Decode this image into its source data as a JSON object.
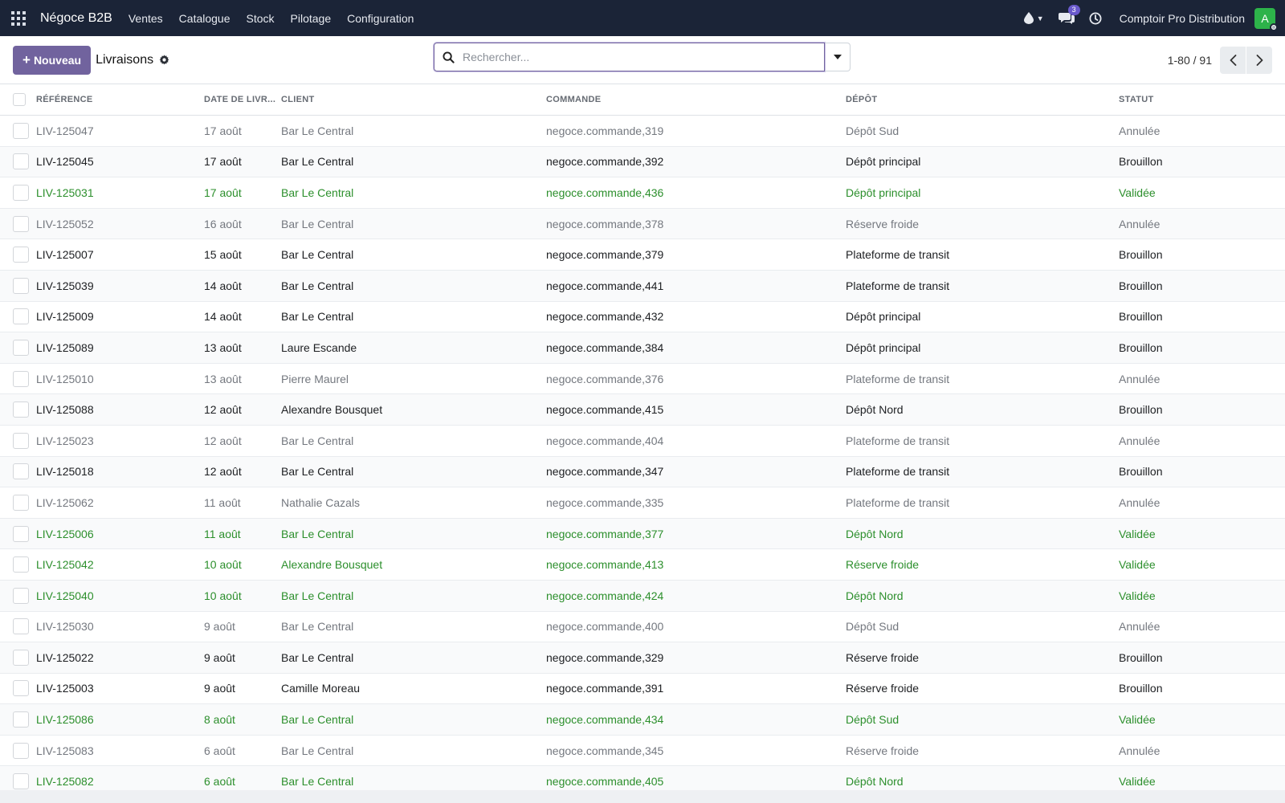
{
  "navbar": {
    "app_name": "Négoce B2B",
    "menu": [
      "Ventes",
      "Catalogue",
      "Stock",
      "Pilotage",
      "Configuration"
    ],
    "messages_count": "3",
    "company": "Comptoir Pro Distribution",
    "avatar_letter": "A"
  },
  "control_panel": {
    "new_button": "Nouveau",
    "title": "Livraisons",
    "search_placeholder": "Rechercher...",
    "pager": "1-80 / 91"
  },
  "table": {
    "headers": [
      "RÉFÉRENCE",
      "DATE DE LIVR...",
      "CLIENT",
      "COMMANDE",
      "DÉPÔT",
      "STATUT"
    ],
    "rows": [
      {
        "ref": "LIV-125047",
        "date": "17 août",
        "client": "Bar Le Central",
        "order": "negoce.commande,319",
        "depot": "Dépôt Sud",
        "status": "Annulée",
        "state": "cancel"
      },
      {
        "ref": "LIV-125045",
        "date": "17 août",
        "client": "Bar Le Central",
        "order": "negoce.commande,392",
        "depot": "Dépôt principal",
        "status": "Brouillon",
        "state": "draft"
      },
      {
        "ref": "LIV-125031",
        "date": "17 août",
        "client": "Bar Le Central",
        "order": "negoce.commande,436",
        "depot": "Dépôt principal",
        "status": "Validée",
        "state": "done"
      },
      {
        "ref": "LIV-125052",
        "date": "16 août",
        "client": "Bar Le Central",
        "order": "negoce.commande,378",
        "depot": "Réserve froide",
        "status": "Annulée",
        "state": "cancel"
      },
      {
        "ref": "LIV-125007",
        "date": "15 août",
        "client": "Bar Le Central",
        "order": "negoce.commande,379",
        "depot": "Plateforme de transit",
        "status": "Brouillon",
        "state": "draft"
      },
      {
        "ref": "LIV-125039",
        "date": "14 août",
        "client": "Bar Le Central",
        "order": "negoce.commande,441",
        "depot": "Plateforme de transit",
        "status": "Brouillon",
        "state": "draft"
      },
      {
        "ref": "LIV-125009",
        "date": "14 août",
        "client": "Bar Le Central",
        "order": "negoce.commande,432",
        "depot": "Dépôt principal",
        "status": "Brouillon",
        "state": "draft"
      },
      {
        "ref": "LIV-125089",
        "date": "13 août",
        "client": "Laure Escande",
        "order": "negoce.commande,384",
        "depot": "Dépôt principal",
        "status": "Brouillon",
        "state": "draft"
      },
      {
        "ref": "LIV-125010",
        "date": "13 août",
        "client": "Pierre Maurel",
        "order": "negoce.commande,376",
        "depot": "Plateforme de transit",
        "status": "Annulée",
        "state": "cancel"
      },
      {
        "ref": "LIV-125088",
        "date": "12 août",
        "client": "Alexandre Bousquet",
        "order": "negoce.commande,415",
        "depot": "Dépôt Nord",
        "status": "Brouillon",
        "state": "draft"
      },
      {
        "ref": "LIV-125023",
        "date": "12 août",
        "client": "Bar Le Central",
        "order": "negoce.commande,404",
        "depot": "Plateforme de transit",
        "status": "Annulée",
        "state": "cancel"
      },
      {
        "ref": "LIV-125018",
        "date": "12 août",
        "client": "Bar Le Central",
        "order": "negoce.commande,347",
        "depot": "Plateforme de transit",
        "status": "Brouillon",
        "state": "draft"
      },
      {
        "ref": "LIV-125062",
        "date": "11 août",
        "client": "Nathalie Cazals",
        "order": "negoce.commande,335",
        "depot": "Plateforme de transit",
        "status": "Annulée",
        "state": "cancel"
      },
      {
        "ref": "LIV-125006",
        "date": "11 août",
        "client": "Bar Le Central",
        "order": "negoce.commande,377",
        "depot": "Dépôt Nord",
        "status": "Validée",
        "state": "done"
      },
      {
        "ref": "LIV-125042",
        "date": "10 août",
        "client": "Alexandre Bousquet",
        "order": "negoce.commande,413",
        "depot": "Réserve froide",
        "status": "Validée",
        "state": "done"
      },
      {
        "ref": "LIV-125040",
        "date": "10 août",
        "client": "Bar Le Central",
        "order": "negoce.commande,424",
        "depot": "Dépôt Nord",
        "status": "Validée",
        "state": "done"
      },
      {
        "ref": "LIV-125030",
        "date": "9 août",
        "client": "Bar Le Central",
        "order": "negoce.commande,400",
        "depot": "Dépôt Sud",
        "status": "Annulée",
        "state": "cancel"
      },
      {
        "ref": "LIV-125022",
        "date": "9 août",
        "client": "Bar Le Central",
        "order": "negoce.commande,329",
        "depot": "Réserve froide",
        "status": "Brouillon",
        "state": "draft"
      },
      {
        "ref": "LIV-125003",
        "date": "9 août",
        "client": "Camille Moreau",
        "order": "negoce.commande,391",
        "depot": "Réserve froide",
        "status": "Brouillon",
        "state": "draft"
      },
      {
        "ref": "LIV-125086",
        "date": "8 août",
        "client": "Bar Le Central",
        "order": "negoce.commande,434",
        "depot": "Dépôt Sud",
        "status": "Validée",
        "state": "done"
      },
      {
        "ref": "LIV-125083",
        "date": "6 août",
        "client": "Bar Le Central",
        "order": "negoce.commande,345",
        "depot": "Réserve froide",
        "status": "Annulée",
        "state": "cancel"
      },
      {
        "ref": "LIV-125082",
        "date": "6 août",
        "client": "Bar Le Central",
        "order": "negoce.commande,405",
        "depot": "Dépôt Nord",
        "status": "Validée",
        "state": "done"
      }
    ]
  },
  "colors": {
    "navbar_bg": "#1b2437",
    "primary": "#71639e",
    "validated": "#2c8f2c",
    "cancelled": "#74787f"
  }
}
